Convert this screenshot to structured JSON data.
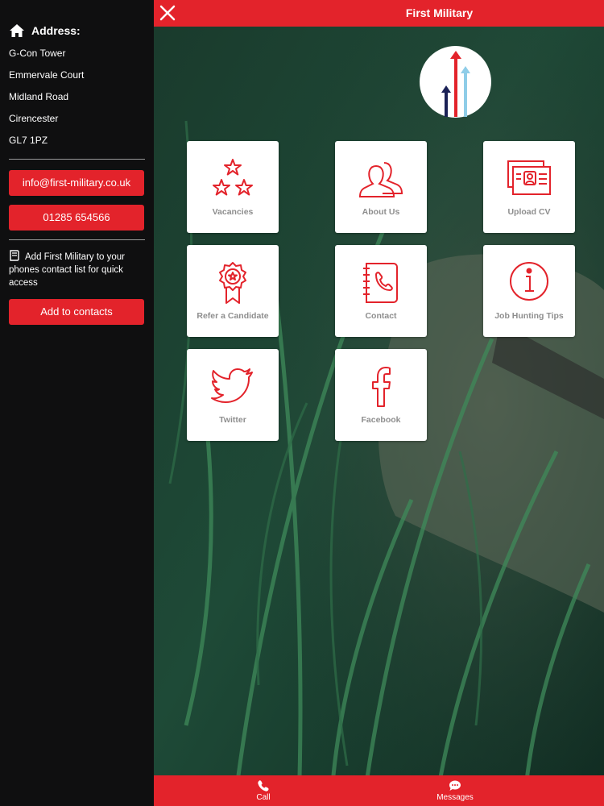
{
  "app": {
    "title": "First Military",
    "brand_color": "#e3232b"
  },
  "sidebar": {
    "address_label": "Address:",
    "address_lines": [
      "G-Con Tower",
      "Emmervale Court",
      "Midland Road",
      "Cirencester",
      "GL7 1PZ"
    ],
    "email": "info@first-military.co.uk",
    "phone": "01285 654566",
    "contact_note": "Add First Military to your phones contact list for quick access",
    "add_contacts": "Add to contacts"
  },
  "tiles": [
    {
      "label": "Vacancies",
      "icon": "stars-icon"
    },
    {
      "label": "About Us",
      "icon": "people-icon"
    },
    {
      "label": "Upload CV",
      "icon": "cv-icon"
    },
    {
      "label": "Refer a Candidate",
      "icon": "rosette-icon"
    },
    {
      "label": "Contact",
      "icon": "contact-book-icon"
    },
    {
      "label": "Job Hunting Tips",
      "icon": "info-icon"
    },
    {
      "label": "Twitter",
      "icon": "twitter-icon"
    },
    {
      "label": "Facebook",
      "icon": "facebook-icon"
    }
  ],
  "bottom_nav": {
    "call": "Call",
    "messages": "Messages"
  }
}
